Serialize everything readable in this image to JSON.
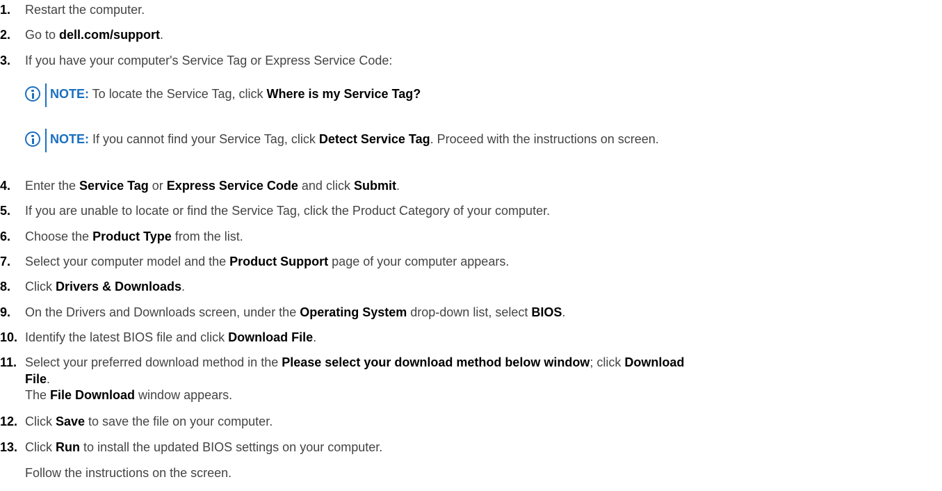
{
  "steps": [
    {
      "num": "1.",
      "parts": [
        "Restart the computer."
      ]
    },
    {
      "num": "2.",
      "parts": [
        "Go to ",
        "dell.com/support",
        "."
      ]
    },
    {
      "num": "3.",
      "parts": [
        "If you have your computer's Service Tag or Express Service Code:"
      ]
    },
    {
      "num": "4.",
      "parts": [
        "Enter the ",
        "Service Tag",
        " or ",
        "Express Service Code",
        " and click ",
        "Submit",
        "."
      ]
    },
    {
      "num": "5.",
      "parts": [
        "If you are unable to locate or find the Service Tag, click the Product Category of your computer."
      ]
    },
    {
      "num": "6.",
      "parts": [
        "Choose the ",
        "Product Type",
        " from the list."
      ]
    },
    {
      "num": "7.",
      "parts": [
        "Select your computer model and the ",
        "Product Support",
        " page of your computer appears."
      ]
    },
    {
      "num": "8.",
      "parts": [
        "Click ",
        "Drivers & Downloads",
        "."
      ]
    },
    {
      "num": "9.",
      "parts": [
        "On the Drivers and Downloads screen, under the ",
        "Operating System",
        " drop-down list, select ",
        "BIOS",
        "."
      ]
    },
    {
      "num": "10.",
      "parts": [
        "Identify the latest BIOS file and click ",
        "Download File",
        "."
      ]
    },
    {
      "num": "11.",
      "parts": [
        "Select your preferred download method in the ",
        "Please select your download method below window",
        "; click ",
        "Download"
      ],
      "line2": [
        "File",
        "."
      ],
      "line3": [
        "The ",
        "File Download",
        " window appears."
      ]
    },
    {
      "num": "12.",
      "parts": [
        "Click ",
        "Save",
        " to save the file on your computer."
      ]
    },
    {
      "num": "13.",
      "parts": [
        "Click ",
        "Run",
        " to install the updated BIOS settings on your computer."
      ],
      "followup": "Follow the instructions on the screen."
    }
  ],
  "notes": [
    {
      "label": "NOTE:",
      "parts": [
        " To locate the Service Tag, click ",
        "Where is my Service Tag?"
      ]
    },
    {
      "label": "NOTE:",
      "parts": [
        " If you cannot find your Service Tag, click ",
        "Detect Service Tag",
        ". Proceed with the instructions on screen."
      ]
    }
  ],
  "colors": {
    "accent": "#1a6fbf",
    "text": "#444444",
    "bold": "#000000"
  },
  "icons": {
    "note": "info-circle-icon"
  }
}
